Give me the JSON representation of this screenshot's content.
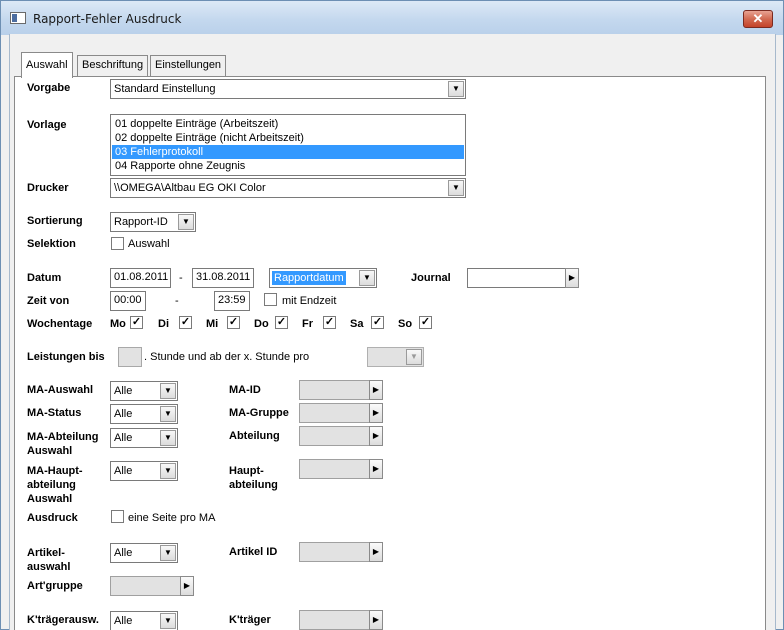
{
  "window": {
    "title": "Rapport-Fehler Ausdruck",
    "close_label": "✕"
  },
  "tabs": [
    {
      "label": "Auswahl",
      "active": true
    },
    {
      "label": "Beschriftung",
      "active": false
    },
    {
      "label": "Einstellungen",
      "active": false
    }
  ],
  "vorgabe": {
    "label": "Vorgabe",
    "value": "Standard Einstellung"
  },
  "vorlage": {
    "label": "Vorlage",
    "items": [
      "01 doppelte Einträge (Arbeitszeit)",
      "02 doppelte Einträge (nicht Arbeitszeit)",
      "03 Fehlerprotokoll",
      "04 Rapporte ohne Zeugnis"
    ],
    "selected": "03 Fehlerprotokoll"
  },
  "drucker": {
    "label": "Drucker",
    "value": "\\\\OMEGA\\Altbau EG OKI Color"
  },
  "sortierung": {
    "label": "Sortierung",
    "value": "Rapport-ID"
  },
  "selektion": {
    "label": "Selektion",
    "checkbox_label": "Auswahl",
    "checked": false
  },
  "datum": {
    "label": "Datum",
    "from": "01.08.2011",
    "dash": "-",
    "to": "31.08.2011",
    "type_value": "Rapportdatum",
    "journal_label": "Journal",
    "journal_value": ""
  },
  "zeit": {
    "label": "Zeit von",
    "from": "00:00",
    "dash": "-",
    "to": "23:59",
    "endzeit_label": "mit Endzeit",
    "endzeit_checked": false
  },
  "wochentage": {
    "label": "Wochentage",
    "days": [
      {
        "label": "Mo",
        "checked": true
      },
      {
        "label": "Di",
        "checked": true
      },
      {
        "label": "Mi",
        "checked": true
      },
      {
        "label": "Do",
        "checked": true
      },
      {
        "label": "Fr",
        "checked": true
      },
      {
        "label": "Sa",
        "checked": true
      },
      {
        "label": "So",
        "checked": true
      }
    ]
  },
  "leistungen": {
    "label": "Leistungen bis",
    "text": ". Stunde und ab der x. Stunde pro",
    "value": ""
  },
  "ma": {
    "auswahl_label": "MA-Auswahl",
    "auswahl_value": "Alle",
    "id_label": "MA-ID",
    "status_label": "MA-Status",
    "status_value": "Alle",
    "gruppe_label": "MA-Gruppe",
    "abteilung_auswahl_label": "MA-Abteilung Auswahl",
    "abteilung_auswahl_value": "Alle",
    "abteilung_label": "Abteilung",
    "haupt_auswahl_label": "MA-Haupt-abteilung Auswahl",
    "haupt_auswahl_value": "Alle",
    "hauptabteilung_label": "Haupt-abteilung"
  },
  "ausdruck": {
    "label": "Ausdruck",
    "checkbox_label": "eine Seite pro MA",
    "checked": false
  },
  "artikel": {
    "auswahl_label": "Artikel-auswahl",
    "auswahl_value": "Alle",
    "id_label": "Artikel ID",
    "gruppe_label": "Art'gruppe"
  },
  "ktraeger": {
    "auswahl_label": "K'trägerausw.",
    "auswahl_value": "Alle",
    "label": "K'träger"
  },
  "icons": {
    "dropdown": "▼",
    "picker": "▶",
    "check": "✓"
  }
}
